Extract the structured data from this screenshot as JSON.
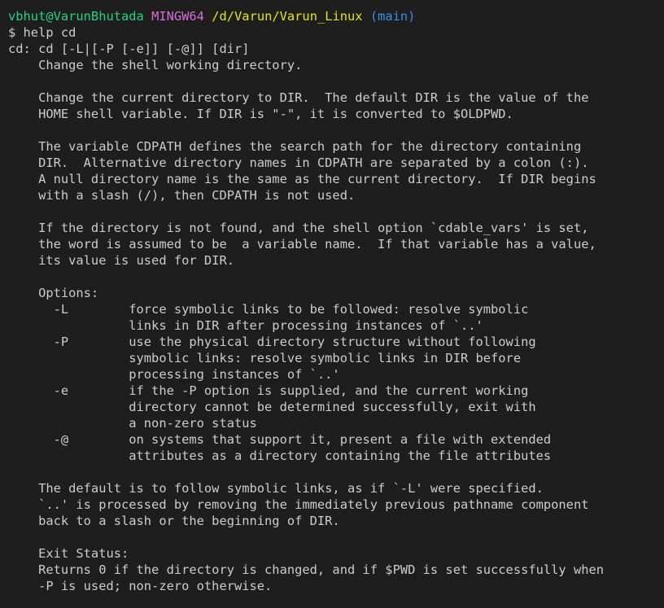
{
  "prompt": {
    "user_host": "vbhut@VarunBhutada",
    "env": "MINGW64",
    "path": "/d/Varun/Varun_Linux",
    "branch": "(main)"
  },
  "command_line": "$ help cd",
  "colors": {
    "background": "#1e1e1e",
    "foreground": "#cccccc",
    "user_host": "#23d18b",
    "env": "#d670d6",
    "path": "#e5e510",
    "branch": "#3b8eea"
  },
  "output_lines": [
    "cd: cd [-L|[-P [-e]] [-@]] [dir]",
    "    Change the shell working directory.",
    "",
    "    Change the current directory to DIR.  The default DIR is the value of the",
    "    HOME shell variable. If DIR is \"-\", it is converted to $OLDPWD.",
    "",
    "    The variable CDPATH defines the search path for the directory containing",
    "    DIR.  Alternative directory names in CDPATH are separated by a colon (:).",
    "    A null directory name is the same as the current directory.  If DIR begins",
    "    with a slash (/), then CDPATH is not used.",
    "",
    "    If the directory is not found, and the shell option `cdable_vars' is set,",
    "    the word is assumed to be  a variable name.  If that variable has a value,",
    "    its value is used for DIR.",
    "",
    "    Options:",
    "      -L        force symbolic links to be followed: resolve symbolic",
    "                links in DIR after processing instances of `..'",
    "      -P        use the physical directory structure without following",
    "                symbolic links: resolve symbolic links in DIR before",
    "                processing instances of `..'",
    "      -e        if the -P option is supplied, and the current working",
    "                directory cannot be determined successfully, exit with",
    "                a non-zero status",
    "      -@        on systems that support it, present a file with extended",
    "                attributes as a directory containing the file attributes",
    "",
    "    The default is to follow symbolic links, as if `-L' were specified.",
    "    `..' is processed by removing the immediately previous pathname component",
    "    back to a slash or the beginning of DIR.",
    "",
    "    Exit Status:",
    "    Returns 0 if the directory is changed, and if $PWD is set successfully when",
    "    -P is used; non-zero otherwise."
  ]
}
